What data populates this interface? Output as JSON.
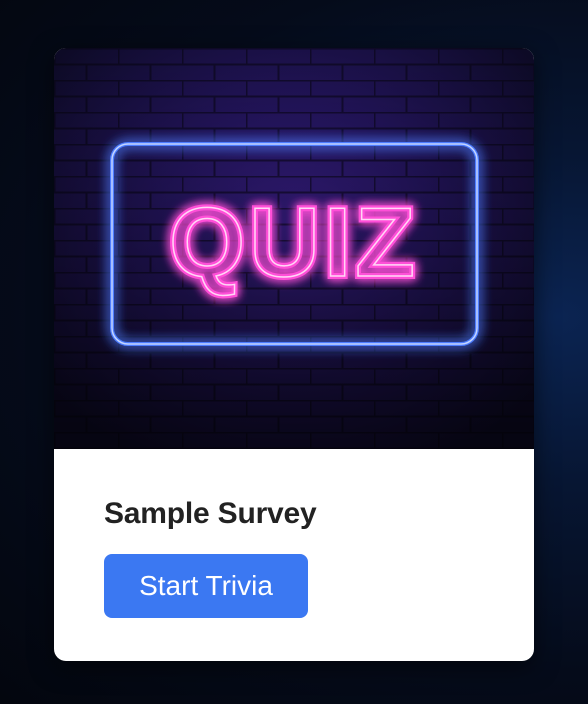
{
  "card": {
    "image": {
      "text": "QUIZ",
      "neon_pink": "#ff4fd8",
      "neon_blue": "#4d7dff",
      "wall_color": "#1a1040"
    },
    "title": "Sample Survey",
    "button_label": "Start Trivia",
    "button_color": "#3b78f2"
  }
}
